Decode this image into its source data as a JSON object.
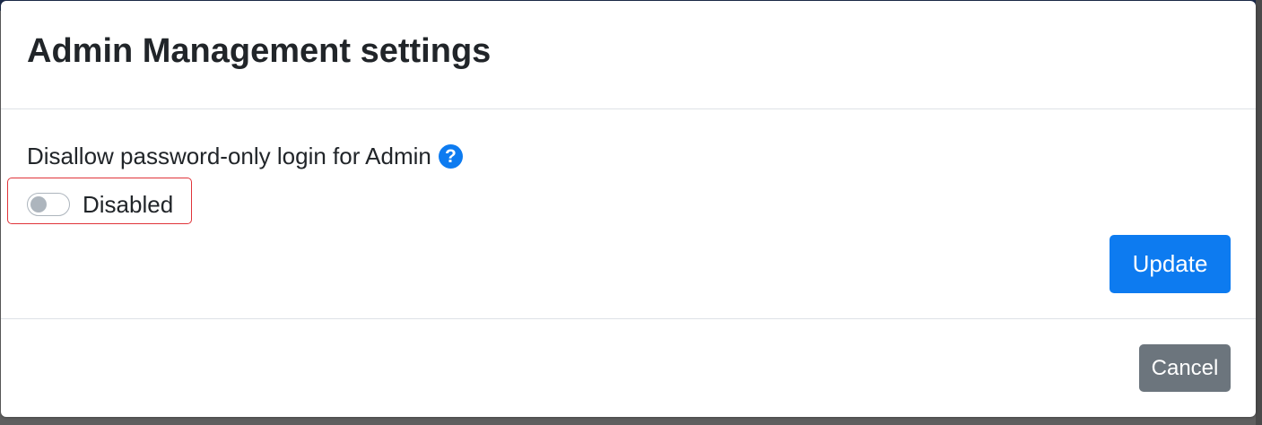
{
  "modal": {
    "title": "Admin Management settings"
  },
  "setting": {
    "label": "Disallow password-only login for Admin",
    "help_icon": "question-circle-icon",
    "help_glyph": "?",
    "toggle": {
      "state": "off",
      "label": "Disabled"
    }
  },
  "actions": {
    "update_label": "Update",
    "cancel_label": "Cancel"
  },
  "colors": {
    "primary": "#0d7bf0",
    "secondary": "#6c757d",
    "highlight": "#e0343a",
    "text": "#212529"
  }
}
